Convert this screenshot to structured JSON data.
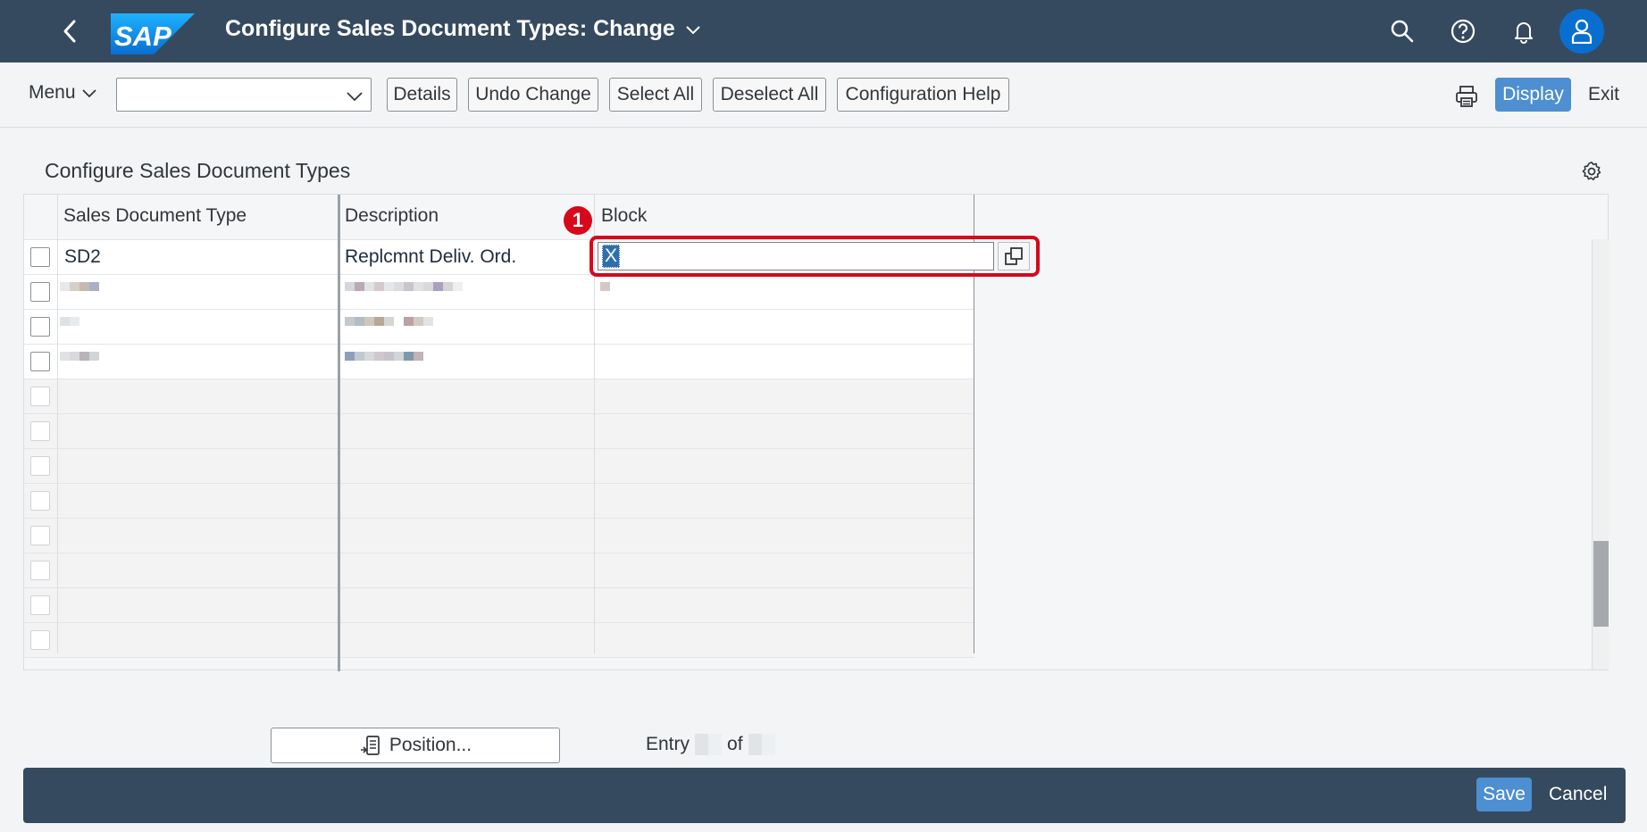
{
  "shell": {
    "title": "Configure Sales Document Types: Change",
    "logo_text": "SAP",
    "icons": [
      "back-icon",
      "chevron-down-icon",
      "search-icon",
      "help-icon",
      "bell-icon",
      "user-icon"
    ]
  },
  "toolbar": {
    "menu_label": "Menu",
    "combo_value": "",
    "buttons": [
      "Details",
      "Undo Change",
      "Select All",
      "Deselect All",
      "Configuration Help"
    ],
    "display_label": "Display",
    "exit_label": "Exit"
  },
  "section": {
    "title": "Configure Sales Document Types"
  },
  "table": {
    "columns": [
      "Sales Document Type",
      "Description",
      "Block"
    ],
    "rows": [
      {
        "type": "SD2",
        "description": "Replcmnt Deliv. Ord.",
        "block": "X"
      }
    ]
  },
  "annotation": {
    "badge": "1",
    "color": "#d7081b"
  },
  "footer_area": {
    "position_label": "Position...",
    "entry_label": "Entry",
    "of_label": "of"
  },
  "footer": {
    "save_label": "Save",
    "cancel_label": "Cancel"
  },
  "colors": {
    "shell": "#354a5f",
    "emphasized_button": "#4d8fd0",
    "background": "#f2f4f6"
  }
}
